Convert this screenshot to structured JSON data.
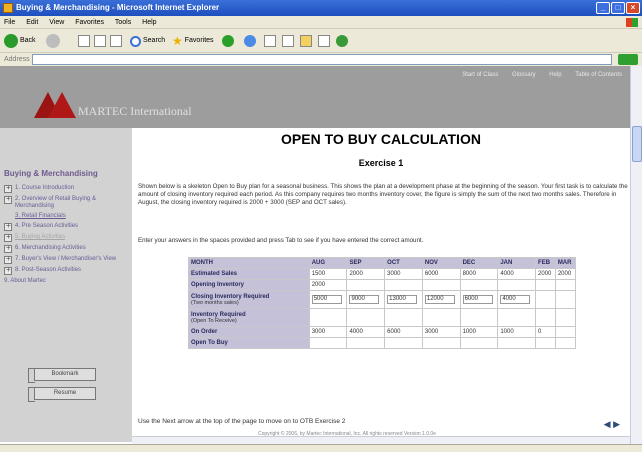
{
  "window": {
    "title": "Buying & Merchandising - Microsoft Internet Explorer"
  },
  "menubar": [
    "File",
    "Edit",
    "View",
    "Favorites",
    "Tools",
    "Help"
  ],
  "toolbar": {
    "back_label": "Back",
    "search_label": "Search",
    "favorites_label": "Favorites"
  },
  "addressbar": {
    "label": "Address"
  },
  "banner": {
    "brand": "MARTEC International",
    "topnav": [
      "Start of Class",
      "Glossary",
      "Help",
      "Table of Contents"
    ]
  },
  "sidebar": {
    "heading": "Buying & Merchandising",
    "items": [
      {
        "label": "1. Course Introduction",
        "underline": false,
        "gray": false,
        "expander": true
      },
      {
        "label": "2. Overview of Retail Buying & Merchandising",
        "underline": false,
        "gray": false,
        "expander": true
      },
      {
        "label": "3. Retail Financials",
        "underline": true,
        "gray": false,
        "expander": false
      },
      {
        "label": "4. Pre Season Activities",
        "underline": false,
        "gray": false,
        "expander": true
      },
      {
        "label": "5. Buying Activities",
        "underline": true,
        "gray": true,
        "expander": true
      },
      {
        "label": "6. Merchandising Activities",
        "underline": false,
        "gray": false,
        "expander": true
      },
      {
        "label": "7. Buyer's View / Merchandiser's View",
        "underline": false,
        "gray": false,
        "expander": true
      },
      {
        "label": "8. Post-Season Activities",
        "underline": false,
        "gray": false,
        "expander": true
      },
      {
        "label": "9. About Martec",
        "underline": false,
        "gray": false,
        "expander": false
      }
    ],
    "bookmark_label": "Bookmark",
    "resume_label": "Resume"
  },
  "content": {
    "title": "OPEN TO BUY CALCULATION",
    "subtitle": "Exercise 1",
    "intro": "Shown below is a skeleton Open to Buy plan for a seasonal business. This shows the plan at a development phase at the beginning of the season. Your first task is to calculate the amount of closing inventory required each period. As this company requires two months inventory cover, the figure is simply the sum of the next two months sales. Therefore in August, the closing inventory required is 2000 + 3000 (SEP and OCT sales).",
    "instruction": "Enter your answers in the spaces provided and press Tab to see if you have entered the correct amount.",
    "next_note": "Use the Next arrow at the top of the page to move on to OTB Exercise 2",
    "copyright": "Copyright © 2006, by Martec International, Inc. All rights reserved Version 1.0.0e"
  },
  "otb_table": {
    "header": [
      "MONTH",
      "AUG",
      "SEP",
      "OCT",
      "NOV",
      "DEC",
      "JAN",
      "FEB",
      "MAR"
    ],
    "rows": [
      {
        "label": "Estimated Sales",
        "sub": "",
        "cells": [
          "1500",
          "2000",
          "3000",
          "6000",
          "8000",
          "4000",
          "2000",
          "2000"
        ],
        "input": false
      },
      {
        "label": "Opening Inventory",
        "sub": "",
        "cells": [
          "2000",
          "",
          "",
          "",
          "",
          "",
          "",
          ""
        ],
        "input": false
      },
      {
        "label": "Closing Inventory Required",
        "sub": "(Two months sales)",
        "cells": [
          "5000",
          "9000",
          "13000",
          "12000",
          "6000",
          "4000",
          "",
          ""
        ],
        "input": true
      },
      {
        "label": "Inventory Required",
        "sub": "(Open To Receive)",
        "cells": [
          "",
          "",
          "",
          "",
          "",
          "",
          "",
          ""
        ],
        "input": false
      },
      {
        "label": "On Order",
        "sub": "",
        "cells": [
          "3000",
          "4000",
          "6000",
          "3000",
          "1000",
          "1000",
          "0",
          ""
        ],
        "input": false
      },
      {
        "label": "Open To Buy",
        "sub": "",
        "cells": [
          "",
          "",
          "",
          "",
          "",
          "",
          "",
          ""
        ],
        "input": false
      }
    ]
  }
}
